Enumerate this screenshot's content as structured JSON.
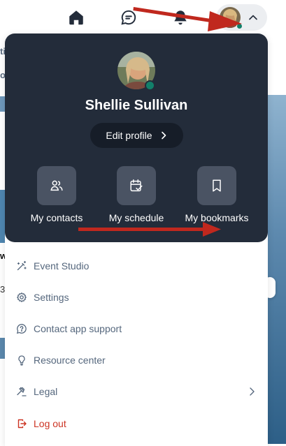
{
  "nav": {
    "icons": [
      "home-icon",
      "chat-icon",
      "bell-icon"
    ],
    "profile_status": "online"
  },
  "background_fragments": [
    "ti",
    "o",
    "w",
    "3"
  ],
  "profile": {
    "name": "Shellie Sullivan",
    "edit_label": "Edit profile"
  },
  "quick_links": [
    {
      "label": "My contacts",
      "icon": "contacts-icon"
    },
    {
      "label": "My schedule",
      "icon": "calendar-check-icon"
    },
    {
      "label": "My bookmarks",
      "icon": "bookmark-icon"
    }
  ],
  "menu": [
    {
      "label": "Event Studio",
      "icon": "magic-wand-icon"
    },
    {
      "label": "Settings",
      "icon": "gear-icon"
    },
    {
      "label": "Contact app support",
      "icon": "help-icon"
    },
    {
      "label": "Resource center",
      "icon": "lightbulb-icon"
    },
    {
      "label": "Legal",
      "icon": "gavel-icon",
      "has_submenu": true
    },
    {
      "label": "Log out",
      "icon": "logout-icon"
    }
  ],
  "colors": {
    "panel_dark": "#232c3a",
    "menu_text": "#55677d",
    "logout": "#cc3322",
    "online": "#12806a",
    "annotation_arrow": "#c0281e"
  }
}
